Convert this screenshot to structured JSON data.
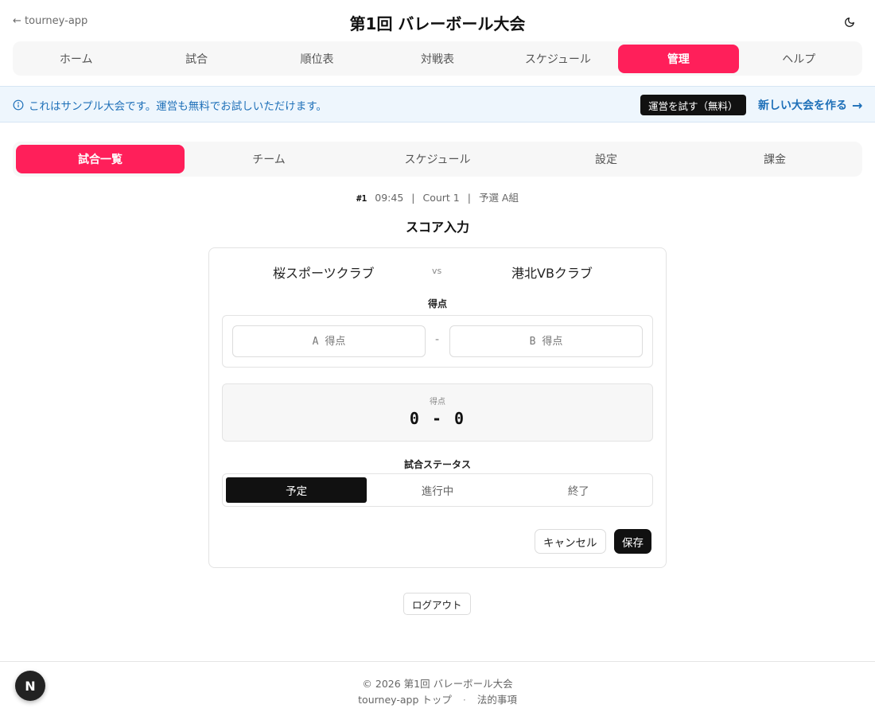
{
  "header": {
    "back_label": "← tourney-app",
    "title": "第1回 バレーボール大会",
    "theme_icon": "moon-icon"
  },
  "main_nav": {
    "tabs": [
      {
        "label": "ホーム",
        "active": false
      },
      {
        "label": "試合",
        "active": false
      },
      {
        "label": "順位表",
        "active": false
      },
      {
        "label": "対戦表",
        "active": false
      },
      {
        "label": "スケジュール",
        "active": false
      },
      {
        "label": "管理",
        "active": true
      },
      {
        "label": "ヘルプ",
        "active": false
      }
    ]
  },
  "banner": {
    "message": "これはサンプル大会です。運営も無料でお試しいただけます。",
    "try_button": "運営を試す（無料）",
    "new_link": "新しい大会を作る"
  },
  "sub_nav": {
    "tabs": [
      {
        "label": "試合一覧",
        "active": true
      },
      {
        "label": "チーム",
        "active": false
      },
      {
        "label": "スケジュール",
        "active": false
      },
      {
        "label": "設定",
        "active": false
      },
      {
        "label": "課金",
        "active": false
      }
    ]
  },
  "match": {
    "number": "#1",
    "time": "09:45",
    "court": "Court 1",
    "group": "予選 A組"
  },
  "score_entry": {
    "title": "スコア入力",
    "team_a": "桜スポーツクラブ",
    "vs": "vs",
    "team_b": "港北VBクラブ",
    "score_label": "得点",
    "input_a_placeholder": "A 得点",
    "input_a_value": "",
    "dash": "-",
    "input_b_placeholder": "B 得点",
    "input_b_value": "",
    "preview_label": "得点",
    "preview_value": "0 - 0",
    "status_label": "試合ステータス",
    "status_options": [
      {
        "label": "予定",
        "active": true
      },
      {
        "label": "進行中",
        "active": false
      },
      {
        "label": "終了",
        "active": false
      }
    ],
    "cancel_label": "キャンセル",
    "save_label": "保存"
  },
  "logout_label": "ログアウト",
  "footer": {
    "copyright": "© 2026 第1回 バレーボール大会",
    "link_top": "tourney-app トップ",
    "separator": "·",
    "link_legal": "法的事項"
  },
  "badge": {
    "letter": "N"
  },
  "colors": {
    "accent": "#ff1f5a",
    "info": "#1d6fb8",
    "dark": "#111111"
  }
}
